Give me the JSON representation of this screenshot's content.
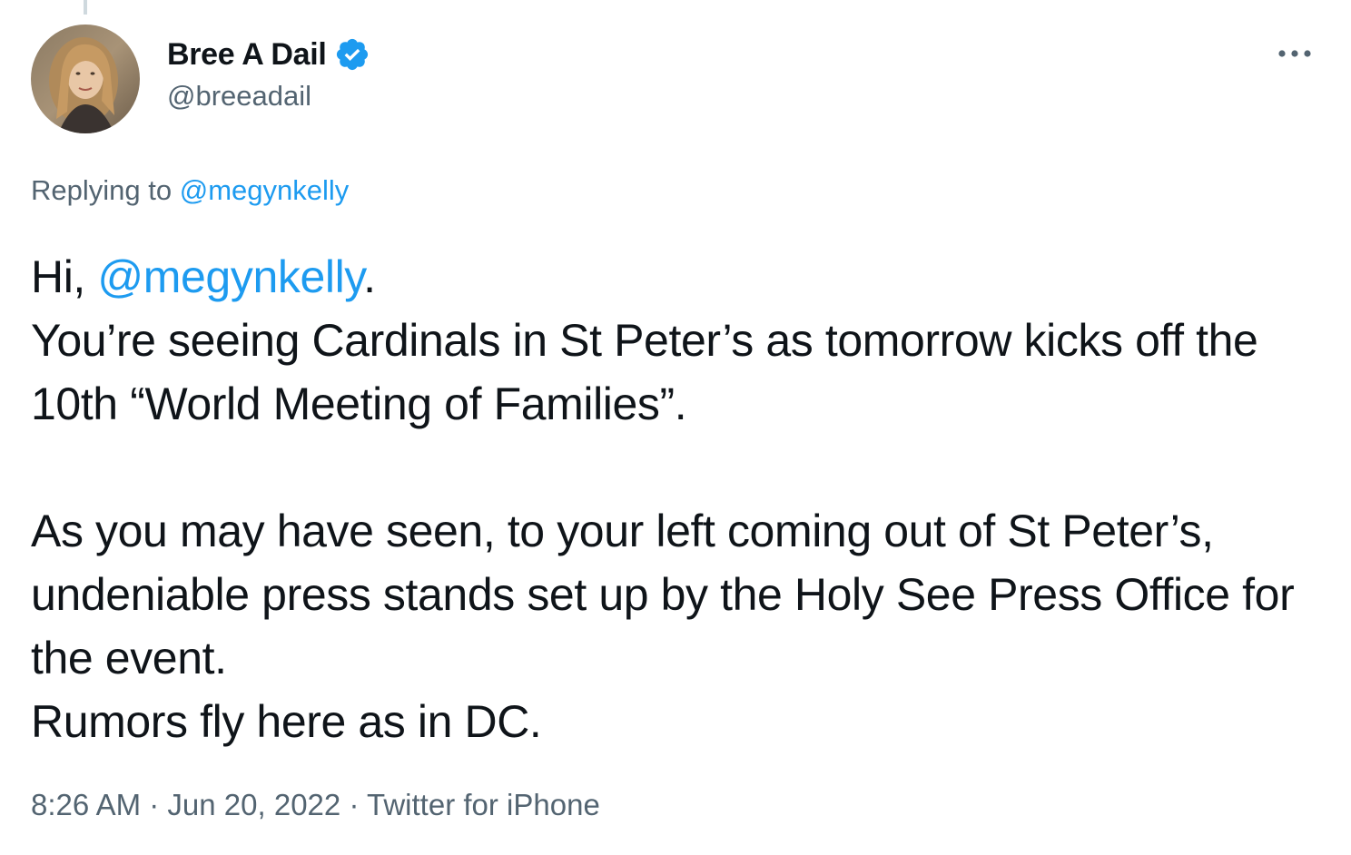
{
  "tweet": {
    "author": {
      "display_name": "Bree A Dail",
      "handle": "@breeadail",
      "verified": true
    },
    "replying_prefix": "Replying to",
    "replying_to": "@megynkelly",
    "body": {
      "greeting": "Hi,",
      "greeting_mention": "@megynkelly",
      "greeting_end": ".",
      "line_2": "You’re seeing Cardinals in St Peter’s as tomorrow kicks off the 10th “World Meeting of Families”.",
      "line_3": "As you may have seen, to your left coming out of St Peter’s, undeniable press stands set up by the Holy See Press Office for the event.",
      "line_4": "Rumors fly here as in DC."
    },
    "time": "8:26 AM",
    "separator": "·",
    "date": "Jun 20, 2022",
    "source": "Twitter for iPhone"
  },
  "icons": {
    "verified": "verified-badge-icon",
    "more": "more-options-icon"
  },
  "colors": {
    "link": "#1d9bf0",
    "secondary_text": "#536471",
    "primary_text": "#0f1419",
    "thread_line": "#cfd9de"
  }
}
